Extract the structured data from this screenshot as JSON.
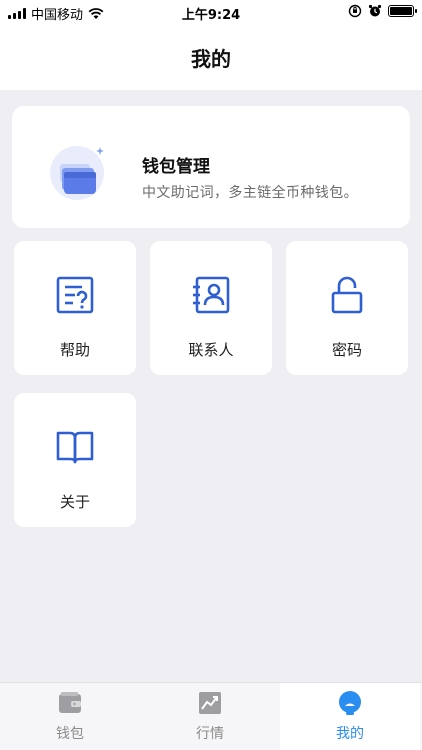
{
  "status_bar": {
    "carrier": "中国移动",
    "time": "上午9:24"
  },
  "nav": {
    "title": "我的"
  },
  "wallet_card": {
    "title": "钱包管理",
    "description": "中文助记词，多主链全币种钱包。",
    "icon": "wallet-stack-icon"
  },
  "tiles": [
    {
      "label": "帮助",
      "icon": "help-document-icon"
    },
    {
      "label": "联系人",
      "icon": "contacts-icon"
    },
    {
      "label": "密码",
      "icon": "unlock-icon"
    },
    {
      "label": "关于",
      "icon": "book-icon"
    }
  ],
  "tab_bar": {
    "tabs": [
      {
        "label": "钱包",
        "icon": "wallet-icon",
        "active": false
      },
      {
        "label": "行情",
        "icon": "trend-chart-icon",
        "active": false
      },
      {
        "label": "我的",
        "icon": "profile-face-icon",
        "active": true
      }
    ]
  },
  "colors": {
    "background": "#eeeef3",
    "icon_blue": "#2f5fd0",
    "tab_active": "#2a8df0",
    "tab_inactive": "#8c8c8c"
  }
}
